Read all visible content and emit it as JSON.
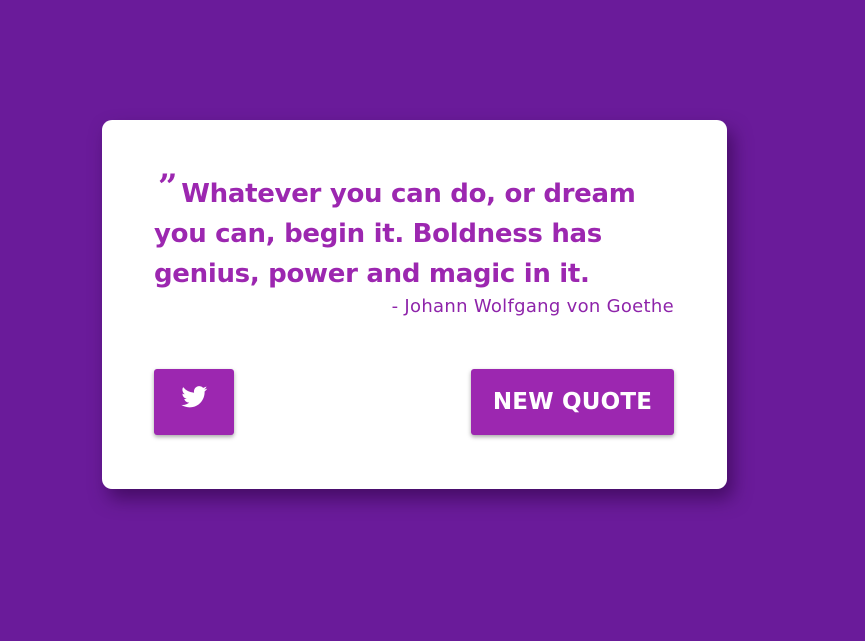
{
  "colors": {
    "background": "#6a1b9a",
    "card": "#ffffff",
    "accent": "#9c27b0",
    "author_text": "#8e24aa"
  },
  "quote": {
    "mark": "”",
    "text": "Whatever you can do, or dream you can, begin it. Boldness has genius, power and magic in it.",
    "author": "- Johann Wolfgang von Goethe"
  },
  "actions": {
    "tweet_icon": "twitter-icon",
    "new_quote_label": "NEW QUOTE"
  }
}
